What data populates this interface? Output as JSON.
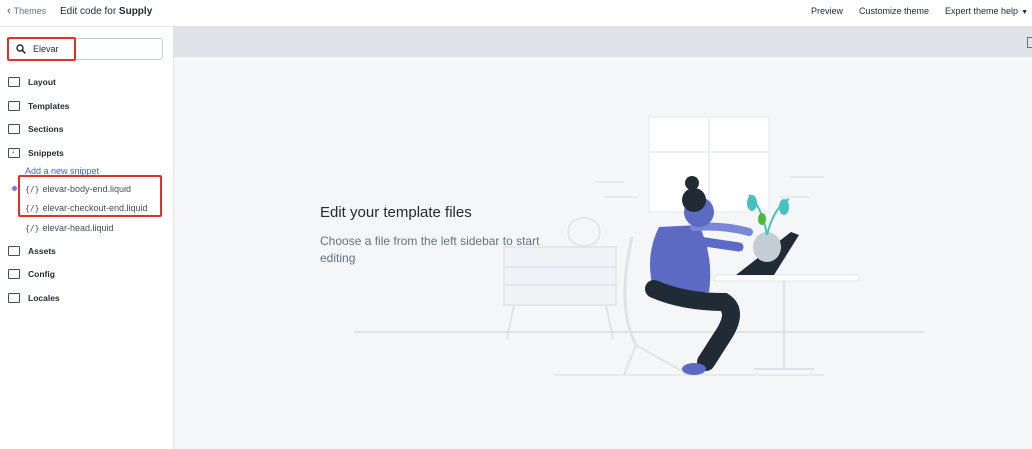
{
  "topbar": {
    "back_label": "Themes",
    "title_prefix": "Edit code for ",
    "title_theme": "Supply",
    "actions": {
      "preview": "Preview",
      "customize": "Customize theme",
      "help": "Expert theme help"
    }
  },
  "sidebar": {
    "search_value": "Elevar",
    "folders": {
      "layout": "Layout",
      "templates": "Templates",
      "sections": "Sections",
      "snippets": "Snippets",
      "assets": "Assets",
      "config": "Config",
      "locales": "Locales"
    },
    "add_snippet": "Add a new snippet",
    "file_bracket": "{/}",
    "files": [
      "elevar-body-end.liquid",
      "elevar-checkout-end.liquid",
      "elevar-head.liquid"
    ]
  },
  "main": {
    "empty_title": "Edit your template files",
    "empty_desc": "Choose a file from the left sidebar to start editing"
  },
  "colors": {
    "highlight": "#e0302b",
    "accent_purple": "#5c6ac4",
    "link_blue": "#2c6ecb",
    "dot_purple": "#9c6ade"
  }
}
